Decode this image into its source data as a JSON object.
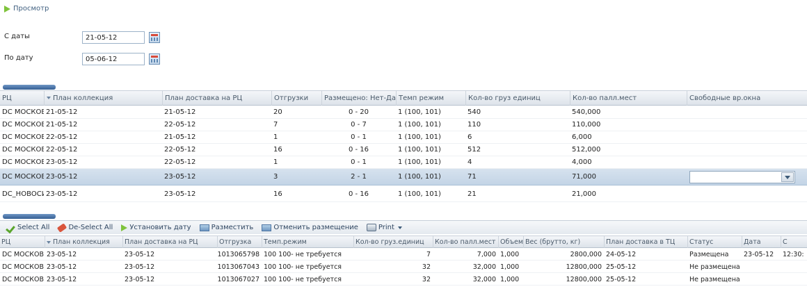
{
  "toolbar_top": {
    "view_label": "Просмотр"
  },
  "filters": {
    "from_label": "С даты",
    "from_value": "21-05-12",
    "to_label": "По дату",
    "to_value": "05-06-12"
  },
  "grid1": {
    "columns": [
      "РЦ",
      "План коллекция",
      "План доставка на РЦ",
      "Отгрузки",
      "Размещено: Нет-Да",
      "Темп режим",
      "Кол-во груз единиц",
      "Кол-во палл.мест",
      "Свободные вр.окна"
    ],
    "rows": [
      [
        "DC МОСКОВ",
        "21-05-12",
        "21-05-12",
        "20",
        "0 - 20",
        "1 (100, 101)",
        "540",
        "540,000",
        ""
      ],
      [
        "DC МОСКОВ",
        "21-05-12",
        "22-05-12",
        "7",
        "0 - 7",
        "1 (100, 101)",
        "110",
        "110,000",
        ""
      ],
      [
        "DC МОСКОВ",
        "22-05-12",
        "21-05-12",
        "1",
        "0 - 1",
        "1 (100, 101)",
        "6",
        "6,000",
        ""
      ],
      [
        "DC МОСКОВ",
        "22-05-12",
        "22-05-12",
        "16",
        "0 - 16",
        "1 (100, 101)",
        "512",
        "512,000",
        ""
      ],
      [
        "DC МОСКОВ",
        "23-05-12",
        "22-05-12",
        "1",
        "0 - 1",
        "1 (100, 101)",
        "4",
        "4,000",
        ""
      ],
      [
        "DC МОСКОВ",
        "23-05-12",
        "23-05-12",
        "3",
        "2 - 1",
        "1 (100, 101)",
        "71",
        "71,000",
        ""
      ],
      [
        "DC_НОВОСИБ",
        "23-05-12",
        "23-05-12",
        "16",
        "0 - 16",
        "1 (100, 101)",
        "21",
        "21,000",
        ""
      ]
    ]
  },
  "actions": {
    "select_all": "Select All",
    "deselect_all": "De-Select All",
    "set_date": "Установить дату",
    "place": "Разместить",
    "cancel_place": "Отменить размещение",
    "print": "Print"
  },
  "grid2": {
    "columns": [
      "РЦ",
      "План коллекция",
      "План доставка на РЦ",
      "Отгрузка",
      "Темп.режим",
      "Кол-во груз.единиц",
      "Кол-во палл.мест",
      "Объем",
      "Вес (брутто, кг)",
      "План доставка в ТЦ",
      "Статус",
      "Дата",
      "С"
    ],
    "rows": [
      [
        "DC МОСКОВ",
        "23-05-12",
        "23-05-12",
        "1013065798",
        "100 100- не требуется",
        "7",
        "7,000",
        "1,000",
        "2800,000",
        "24-05-12",
        "Размещена",
        "23-05-12",
        "12:30:"
      ],
      [
        "DC МОСКОВ",
        "23-05-12",
        "23-05-12",
        "1013067043",
        "100 100- не требуется",
        "32",
        "32,000",
        "1,000",
        "12800,000",
        "25-05-12",
        "Не размещена",
        "",
        ""
      ],
      [
        "DC МОСКОВ",
        "23-05-12",
        "23-05-12",
        "1013067027",
        "100 100- не требуется",
        "32",
        "32,000",
        "1,000",
        "12800,000",
        "25-05-12",
        "Не размещена",
        "",
        ""
      ]
    ]
  },
  "icons": {
    "view": "play-icon",
    "calendar": "calendar-icon",
    "select_all": "check-icon",
    "deselect_all": "eraser-icon",
    "set_date": "play-icon",
    "place": "place-icon",
    "print": "printer-icon"
  },
  "colors": {
    "accent_green": "#7fc33b",
    "selected_row": "#c9d8e8",
    "header_text": "#4a5a6a"
  }
}
